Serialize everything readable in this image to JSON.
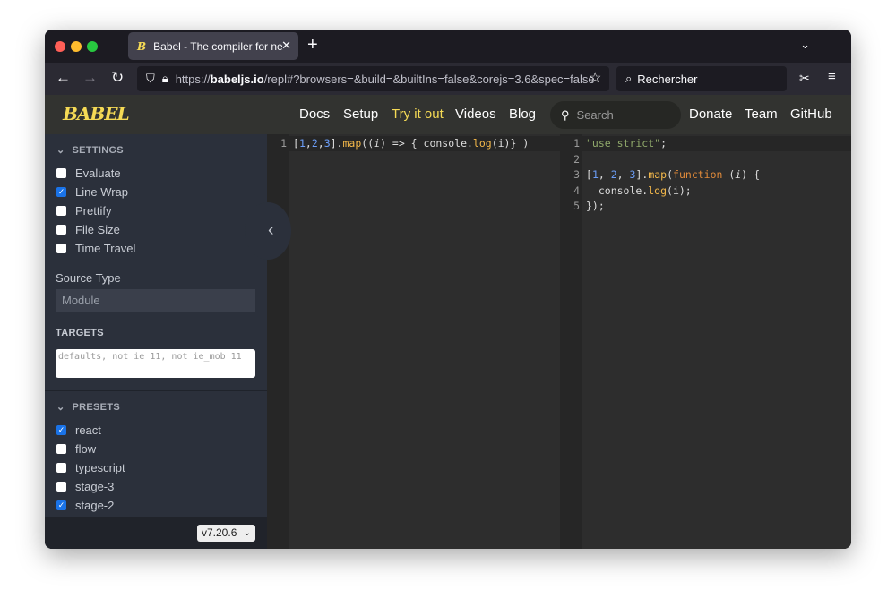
{
  "browser": {
    "tab_title": "Babel - The compiler for next generation JavaScript",
    "tab_favicon": "B",
    "url_prefix": "https://",
    "url_domain": "babeljs.io",
    "url_path": "/repl#?browsers=&build=&builtIns=false&corejs=3.6&spec=false",
    "search_placeholder": "Rechercher"
  },
  "site": {
    "logo": "BABEL",
    "nav": [
      "Docs",
      "Setup",
      "Try it out",
      "Videos",
      "Blog"
    ],
    "nav_right": [
      "Donate",
      "Team",
      "GitHub"
    ],
    "search_placeholder": "Search",
    "active_color": "#f5da55"
  },
  "settings": {
    "title": "SETTINGS",
    "items": [
      {
        "label": "Evaluate",
        "checked": false
      },
      {
        "label": "Line Wrap",
        "checked": true
      },
      {
        "label": "Prettify",
        "checked": false
      },
      {
        "label": "File Size",
        "checked": false
      },
      {
        "label": "Time Travel",
        "checked": false
      }
    ],
    "source_type_label": "Source Type",
    "source_type": "Module",
    "targets_label": "TARGETS",
    "targets": "defaults, not ie 11, not ie_mob 11"
  },
  "presets": {
    "title": "PRESETS",
    "items": [
      {
        "label": "react",
        "checked": true
      },
      {
        "label": "flow",
        "checked": false
      },
      {
        "label": "typescript",
        "checked": false
      },
      {
        "label": "stage-3",
        "checked": false
      },
      {
        "label": "stage-2",
        "checked": true
      }
    ]
  },
  "version": "v7.20.6",
  "input": [
    [
      [
        "[",
        "#ddd"
      ],
      [
        "1",
        "#6c9ef8"
      ],
      [
        ",",
        "#ddd"
      ],
      [
        "2",
        "#6c9ef8"
      ],
      [
        ",",
        "#ddd"
      ],
      [
        "3",
        "#6c9ef8"
      ],
      [
        "].",
        "#ddd"
      ],
      [
        "map",
        "#f5b94a"
      ],
      [
        "((",
        "#ddd"
      ],
      [
        "i",
        "#ddd"
      ],
      [
        ") => { console.",
        "#ddd"
      ],
      [
        "log",
        "#f5b94a"
      ],
      [
        "(i)} )",
        "#ddd"
      ]
    ]
  ],
  "output": [
    [
      [
        "\"use strict\"",
        "#8fa86a"
      ],
      [
        ";",
        "#ddd"
      ]
    ],
    [],
    [
      [
        "[",
        "#ddd"
      ],
      [
        "1",
        "#6c9ef8"
      ],
      [
        ", ",
        "#ddd"
      ],
      [
        "2",
        "#6c9ef8"
      ],
      [
        ", ",
        "#ddd"
      ],
      [
        "3",
        "#6c9ef8"
      ],
      [
        "].",
        "#ddd"
      ],
      [
        "map",
        "#f5b94a"
      ],
      [
        "(",
        "#ddd"
      ],
      [
        "function",
        "#e08a3a"
      ],
      [
        " (",
        "#ddd"
      ],
      [
        "i",
        "#ddd"
      ],
      [
        ") {",
        "#ddd"
      ]
    ],
    [
      [
        "  console.",
        "#ddd"
      ],
      [
        "log",
        "#f5b94a"
      ],
      [
        "(i);",
        "#ddd"
      ]
    ],
    [
      [
        "});",
        "#ddd"
      ]
    ]
  ]
}
